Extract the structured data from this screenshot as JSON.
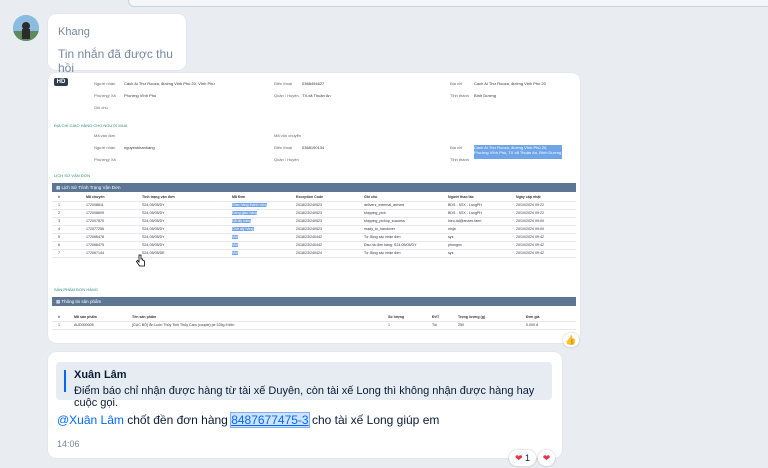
{
  "msg1": {
    "sender": "Khang",
    "text": "Tin nhắn đã được thu hồi"
  },
  "screenshot": {
    "badge": "HD",
    "info": [
      {
        "label": "Người nhận",
        "value": "Cách Ai Thư Rooza, đường Vinh Phú 20, Vĩnh Phú",
        "l2": "Điện thoại",
        "v2": "0368494627",
        "l3": "Địa chỉ",
        "v3": "Cách Ai Thư Rooza, đường Vinh Phú 20"
      },
      {
        "label": "Phường/ Xã",
        "value": "Phường Vĩnh Phú",
        "l2": "Quận / Huyện",
        "v2": "TX.xã Thuận An",
        "l3": "Tỉnh thành",
        "v3": "Bình Dương"
      },
      {
        "label": "Ghi chú",
        "value": ""
      }
    ],
    "sec_receiver": "ĐỊA CHỈ GIAO HÀNG CHO NGƯỜI MUA",
    "info2": [
      {
        "label": "Mã vận đơn",
        "value": "",
        "l2": "Mã vận chuyển",
        "v2": ""
      },
      {
        "label": "Người nhận",
        "value": "nguyenkhanhang",
        "l2": "Điện thoại",
        "v2": "0368190134",
        "l3": "Địa chỉ",
        "v3": "Cách Ai Thư Rooza, đường Vĩnh Phú 20, Phường Vĩnh Phú, TX.xã Thuận An, Bình Dương"
      },
      {
        "label": "Phường/ Xã",
        "value": "",
        "l2": "Quận / Huyện",
        "v2": "",
        "l3": "Tỉnh thành",
        "v3": ""
      }
    ],
    "sec_history": "LỊCH SỬ VẬN ĐƠN",
    "grid1_title": "Lịch Sử Trình Trạng Vận Đơn",
    "grid1_cols": [
      "#",
      "Mã chuyến",
      "Tình trạng vận đơn",
      "Mã Đơn",
      "Exception Code",
      "Ghi chú",
      "Người thao tác",
      "Ngày cập nhật"
    ],
    "grid1_rows": [
      [
        "1",
        "172008611",
        "S24-05/05/DY",
        "Giao hàng thành công",
        "2018/23/240523",
        "deliverz_external_arrived",
        "BDS - SSX - LongPH",
        "20/10/2024 09:22"
      ],
      [
        "2",
        "172008609",
        "S24-05/05/DY",
        "Đang giao hàng",
        "2018/23/240523",
        "shipping_pick",
        "BDS - SSX - LongPH",
        "20/10/2024 09:22"
      ],
      [
        "3",
        "172007870",
        "S24-05/05/DY",
        "Đã lấy hàng",
        "2018/23/240523",
        "shipping_pickup_success",
        "hieu.dd@enzen.farm",
        "20/10/2024 09:00"
      ],
      [
        "4",
        "172077256",
        "S24-05/05/DY",
        "Chờ lấy hàng",
        "2018/23/240523",
        "ready_to_handover",
        "ninja",
        "20/10/2024 09:00"
      ],
      [
        "5",
        "172066478",
        "S24-05/05/DY",
        "Mới",
        "2018/23/240442",
        "Tự động xác nhận đơn",
        "sys",
        "20/10/2024 09:42"
      ],
      [
        "6",
        "172066475",
        "S24-05/05/DY",
        "Mới",
        "2018/23/240442",
        "Đầu hà đơn hàng: S24-05/05/DY",
        "phongnv",
        "20/10/2024 09:42"
      ],
      [
        "7",
        "172067144",
        "S24-05/05/DE",
        "Mới",
        "2018/23/240424",
        "Tự động xác nhận đơn",
        "sys",
        "20/10/2024 09:42"
      ]
    ],
    "sec_product": "SẢN PHẨM ĐƠN HÀNG",
    "grid2_title": "Thông tin sản phẩm",
    "grid2_cols": [
      "#",
      "Mã sản phẩm",
      "Tên sản phẩm",
      "Số lượng",
      "ĐVT",
      "Trọng lượng (g)",
      "Đơn giá"
    ],
    "grid2_rows": [
      [
        "1",
        "AUD000005",
        "[CỤC BỘ] Ăn Luôn Thủy Tinh Thủy Cam (couple) pe 225g ít tiền",
        "1",
        "Túi",
        "250",
        "0.000 đ"
      ]
    ]
  },
  "msg3": {
    "quote_author": "Xuân Lâm",
    "quote_text": "Điểm báo chỉ nhận được hàng từ tài xế Duyên, còn tài xế Long thì không nhận được hàng hay cuộc gọi.",
    "mention": "@Xuân Lâm",
    "text_before": " chốt đền đơn hàng ",
    "order_code": "8487677475-3",
    "text_after": " cho tài xế Long giúp em",
    "time": "14:06"
  },
  "reactions": {
    "heart_count": "1"
  },
  "icons": {
    "reaction": "heart-icon",
    "like": "like-icon",
    "cursor": "hand-cursor-icon"
  },
  "colors": {
    "accent": "#0068ff",
    "heart": "#e8344a",
    "grid_header": "#5c7693",
    "highlight": "#6fa4e8"
  }
}
